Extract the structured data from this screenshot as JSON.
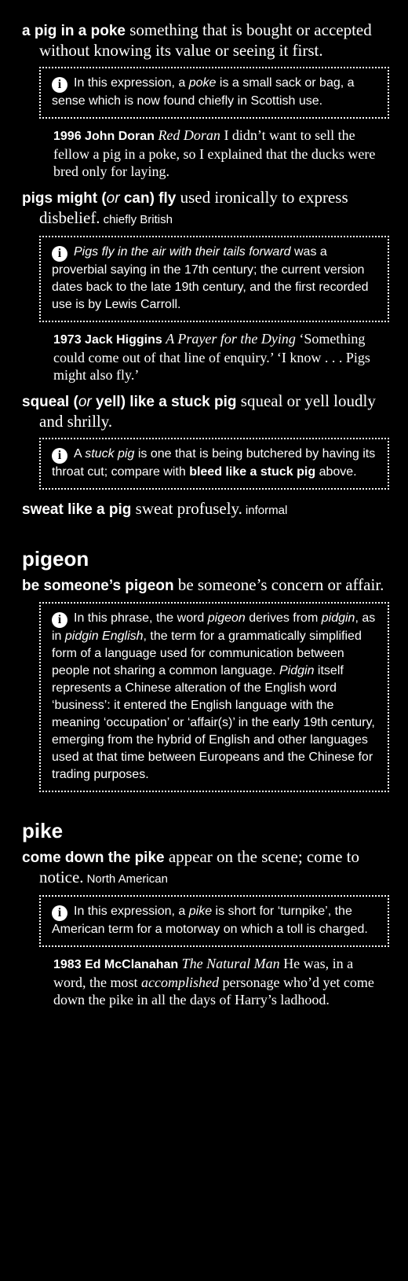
{
  "entries": {
    "pig_in_poke": {
      "phrase": "a pig in a poke",
      "definition": "something that is bought or accepted without knowing its value or seeing it first.",
      "note": {
        "text_a": "In this expression, a ",
        "italic": "poke",
        "text_b": " is a small sack or bag, a sense which is now found chiefly in Scottish use."
      },
      "quote": {
        "year_author": "1996 John Doran",
        "work": "Red Doran",
        "text": "I didn’t want to sell the fellow a pig in a poke, so I explained that the ducks were bred only for laying."
      }
    },
    "pigs_might_fly": {
      "phrase_a": "pigs might (",
      "phrase_or": "or",
      "phrase_b": " can) fly",
      "definition": "used ironically to express disbelief.",
      "label": "chiefly British",
      "note": {
        "italic": "Pigs fly in the air with their tails forward",
        "text": " was a proverbial saying in the 17th century; the current version dates back to the late 19th century, and the first recorded use is by Lewis Carroll."
      },
      "quote": {
        "year_author": "1973 Jack Higgins",
        "work": "A Prayer for the Dying",
        "text": "‘Something could come out of that line of enquiry.’ ‘I know . . . Pigs might also fly.’"
      }
    },
    "stuck_pig": {
      "phrase_a": "squeal (",
      "phrase_or": "or",
      "phrase_b": " yell) like a stuck pig",
      "definition": "squeal or yell loudly and shrilly.",
      "note": {
        "text_a": "A ",
        "italic": "stuck pig",
        "text_b": " is one that is being butchered by having its throat cut; compare with ",
        "bold": "bleed like a stuck pig",
        "text_c": " above."
      }
    },
    "sweat_pig": {
      "phrase": "sweat like a pig",
      "definition": "sweat profusely.",
      "label": "informal"
    },
    "pigeon": {
      "headword": "pigeon",
      "phrase": "be someone’s pigeon",
      "definition": "be someone’s concern or affair.",
      "note": {
        "t1": "In this phrase, the word ",
        "i1": "pigeon",
        "t2": " derives from ",
        "i2": "pidgin",
        "t3": ", as in ",
        "i3": "pidgin English",
        "t4": ", the term for a grammatically simplified form of a language used for communication between people not sharing a common language. ",
        "i4": "Pidgin",
        "t5": " itself represents a Chinese alteration of the English word ‘business’: it entered the English language with the meaning ‘occupation’ or ‘affair(s)’ in the early 19th century, emerging from the hybrid of English and other languages used at that time between Europeans and the Chinese for trading purposes."
      }
    },
    "pike": {
      "headword": "pike",
      "phrase": "come down the pike",
      "definition": "appear on the scene; come to notice.",
      "label": "North American",
      "note": {
        "text_a": "In this expression, a ",
        "italic": "pike",
        "text_b": " is short for ‘turnpike’, the American term for a motorway on which a toll is charged."
      },
      "quote": {
        "year_author": "1983 Ed McClanahan",
        "work": "The Natural Man",
        "text_a": "He was, in a word, the most ",
        "italic": "accomplished",
        "text_b": " personage who’d yet come down the pike in all the days of Harry’s ladhood."
      }
    }
  },
  "icons": {
    "info": "i"
  }
}
